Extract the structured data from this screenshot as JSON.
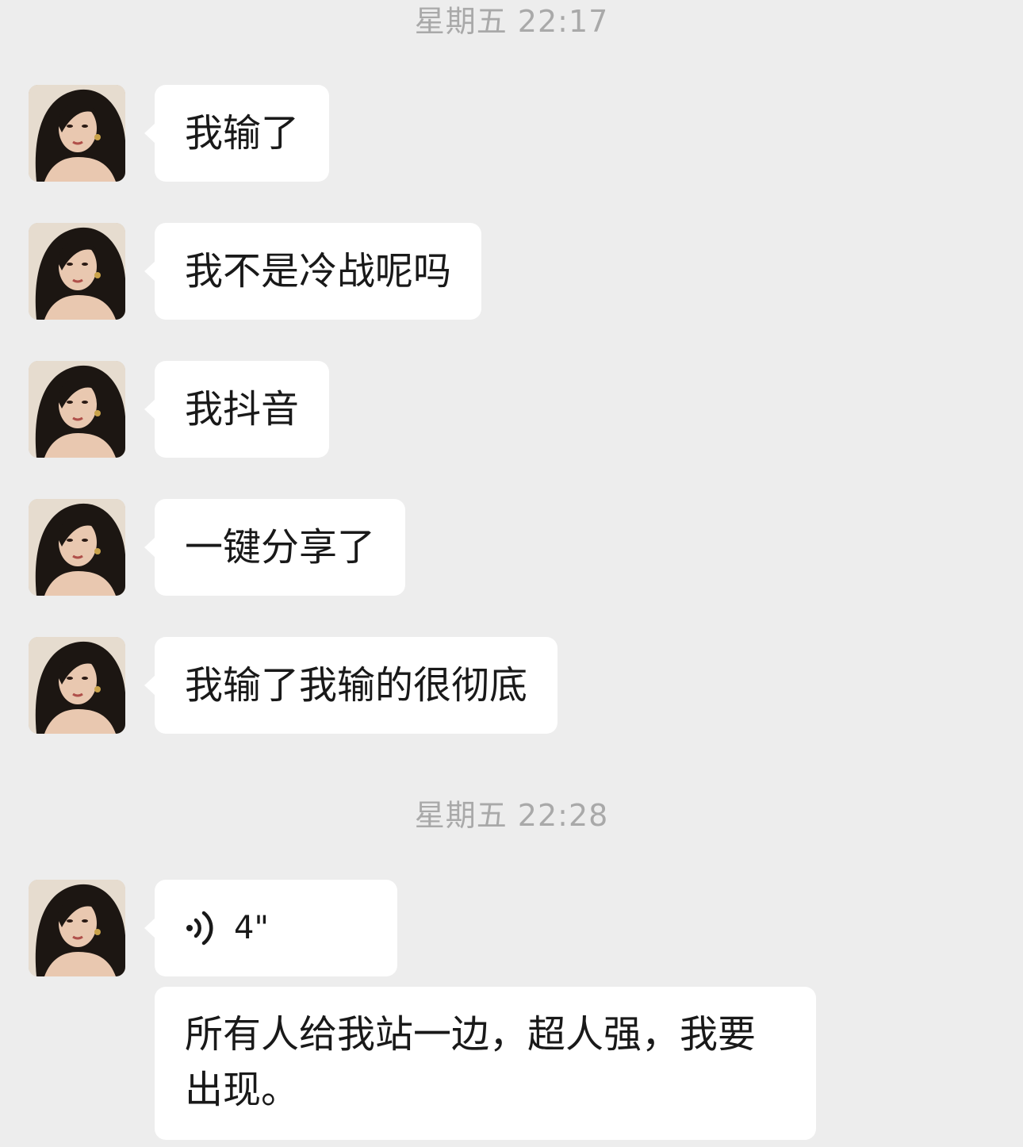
{
  "timestamps": [
    "星期五 22:17",
    "星期五 22:28"
  ],
  "messages": [
    {
      "text": "我输了"
    },
    {
      "text": "我不是冷战呢吗"
    },
    {
      "text": "我抖音"
    },
    {
      "text": "一键分享了"
    },
    {
      "text": "我输了我输的很彻底"
    }
  ],
  "voice_message": {
    "duration": "4\""
  },
  "last_message": {
    "text": "所有人给我站一边，超人强，我要出现。"
  },
  "colors": {
    "background": "#ededed",
    "bubble": "#ffffff",
    "timestamp": "#a9a9a9",
    "text": "#191919"
  },
  "icons": {
    "avatar": "avatar-portrait",
    "voice": "voice-wave-icon"
  }
}
